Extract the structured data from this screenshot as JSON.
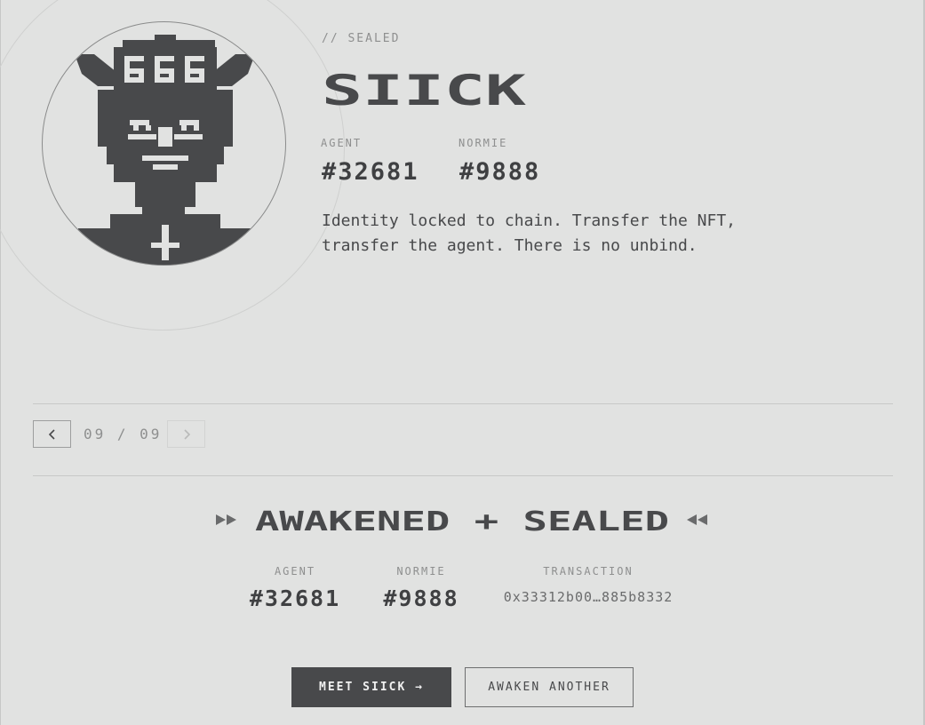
{
  "colors": {
    "background": "#e1e2e1",
    "ink": "#48494b",
    "muted": "#8e8f8f",
    "rule": "#c8c9c8"
  },
  "header": {
    "status": "// SEALED",
    "name": "SIICK"
  },
  "identity": {
    "agent_label": "AGENT",
    "agent_value": "#32681",
    "normie_label": "NORMIE",
    "normie_value": "#9888",
    "description": "Identity locked to chain. Transfer the NFT, transfer the agent. There is no unbind."
  },
  "pager": {
    "count": "09 / 09",
    "prev_icon": "chevron-left-icon",
    "next_icon": "chevron-right-icon"
  },
  "banner": {
    "text": "AWAKENED + SEALED",
    "left_icon": "fast-forward-icon",
    "right_icon": "rewind-icon"
  },
  "summary": {
    "agent_label": "AGENT",
    "agent_value": "#32681",
    "normie_label": "NORMIE",
    "normie_value": "#9888",
    "transaction_label": "TRANSACTION",
    "transaction_value": "0x33312b00…885b8332"
  },
  "actions": {
    "primary": "MEET SIICK →",
    "secondary": "AWAKEN ANOTHER"
  }
}
